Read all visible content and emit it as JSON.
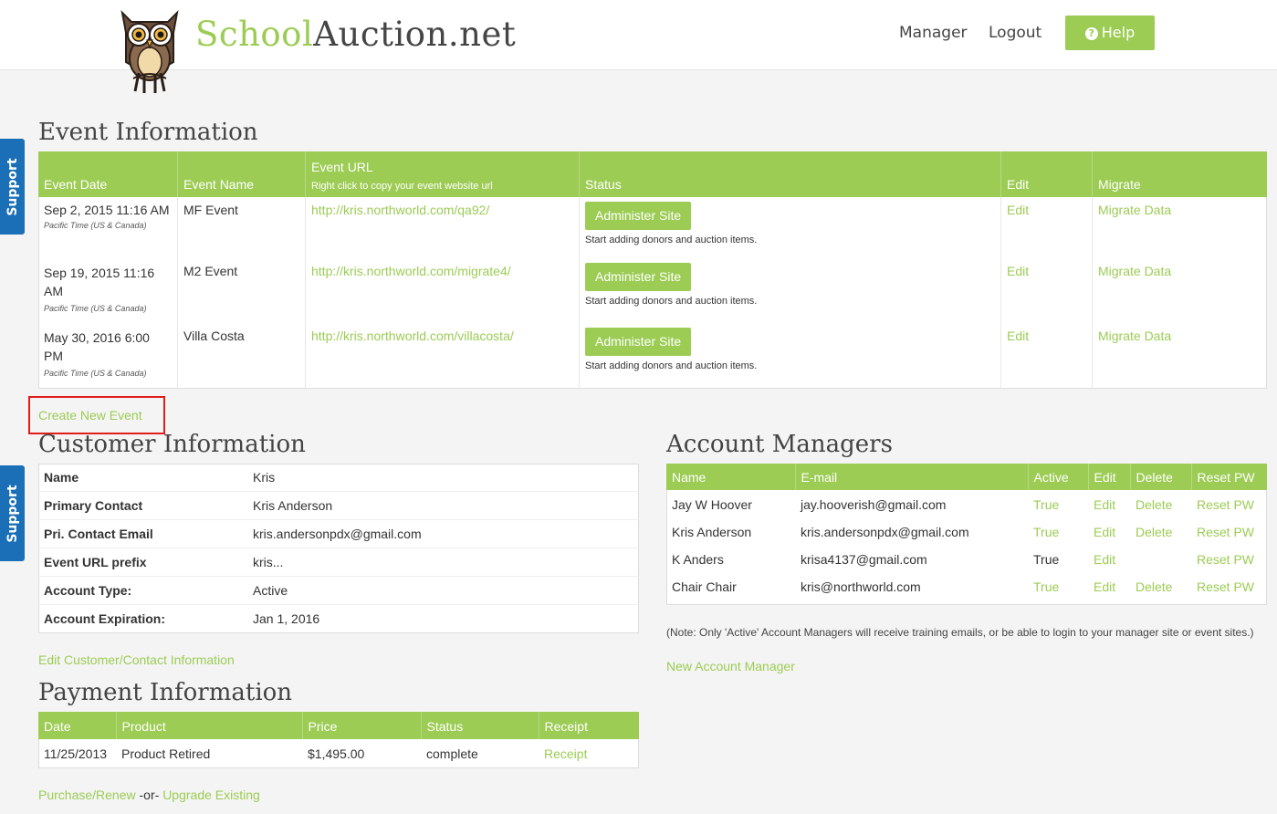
{
  "header": {
    "logo_part1": "School",
    "logo_part2": "Auction.net",
    "nav_manager": "Manager",
    "nav_logout": "Logout",
    "help_label": "Help"
  },
  "support_label": "Support",
  "event_info": {
    "title": "Event Information",
    "columns": {
      "date": "Event Date",
      "name": "Event Name",
      "url": "Event URL",
      "url_hint": "Right click to copy your event website url",
      "status": "Status",
      "edit": "Edit",
      "migrate": "Migrate"
    },
    "rows": [
      {
        "date": "Sep 2, 2015 11:16 AM",
        "tz": "Pacific Time (US & Canada)",
        "name": "MF Event",
        "url": "http://kris.northworld.com/qa92/",
        "status_btn": "Administer Site",
        "status_note": "Start adding donors and auction items.",
        "edit": "Edit",
        "migrate": "Migrate Data"
      },
      {
        "date": "Sep 19, 2015 11:16 AM",
        "tz": "Pacific Time (US & Canada)",
        "name": "M2 Event",
        "url": "http://kris.northworld.com/migrate4/",
        "status_btn": "Administer Site",
        "status_note": "Start adding donors and auction items.",
        "edit": "Edit",
        "migrate": "Migrate Data"
      },
      {
        "date": "May 30, 2016 6:00 PM",
        "tz": "Pacific Time (US & Canada)",
        "name": "Villa Costa",
        "url": "http://kris.northworld.com/villacosta/",
        "status_btn": "Administer Site",
        "status_note": "Start adding donors and auction items.",
        "edit": "Edit",
        "migrate": "Migrate Data"
      }
    ],
    "create_link": "Create New Event"
  },
  "customer_info": {
    "title": "Customer Information",
    "rows": [
      {
        "label": "Name",
        "value": "Kris"
      },
      {
        "label": "Primary Contact",
        "value": "Kris Anderson"
      },
      {
        "label": "Pri. Contact Email",
        "value": "kris.andersonpdx@gmail.com"
      },
      {
        "label": "Event URL prefix",
        "value": "kris..."
      },
      {
        "label": "Account Type:",
        "value": "Active"
      },
      {
        "label": "Account Expiration:",
        "value": "Jan 1, 2016"
      }
    ],
    "edit_link": "Edit Customer/Contact Information"
  },
  "account_managers": {
    "title": "Account Managers",
    "columns": {
      "name": "Name",
      "email": "E-mail",
      "active": "Active",
      "edit": "Edit",
      "delete": "Delete",
      "reset": "Reset PW"
    },
    "rows": [
      {
        "name": "Jay W Hoover",
        "email": "jay.hooverish@gmail.com",
        "active": "True",
        "active_link": true,
        "edit": "Edit",
        "delete": "Delete",
        "reset": "Reset PW"
      },
      {
        "name": "Kris Anderson",
        "email": "kris.andersonpdx@gmail.com",
        "active": "True",
        "active_link": true,
        "edit": "Edit",
        "delete": "Delete",
        "reset": "Reset PW"
      },
      {
        "name": "K Anders",
        "email": "krisa4137@gmail.com",
        "active": "True",
        "active_link": false,
        "edit": "Edit",
        "delete": "",
        "reset": "Reset PW"
      },
      {
        "name": "Chair Chair",
        "email": "kris@northworld.com",
        "active": "True",
        "active_link": true,
        "edit": "Edit",
        "delete": "Delete",
        "reset": "Reset PW"
      }
    ],
    "note": "(Note: Only 'Active' Account Managers will receive training emails, or be able to login to your manager site or event sites.)",
    "new_link": "New Account Manager"
  },
  "payment_info": {
    "title": "Payment Information",
    "columns": {
      "date": "Date",
      "product": "Product",
      "price": "Price",
      "status": "Status",
      "receipt": "Receipt"
    },
    "rows": [
      {
        "date": "11/25/2013",
        "product": "Product Retired",
        "price": "$1,495.00",
        "status": "complete",
        "receipt": "Receipt"
      }
    ],
    "purchase_link": "Purchase/Renew",
    "or_text": "-or-",
    "upgrade_link": "Upgrade Existing"
  },
  "colors": {
    "accent": "#9ccc54",
    "support_blue": "#1a6fb6",
    "highlight_red": "#e01c1c"
  },
  "icons": [
    "owl-logo-icon",
    "question-circle-icon"
  ]
}
